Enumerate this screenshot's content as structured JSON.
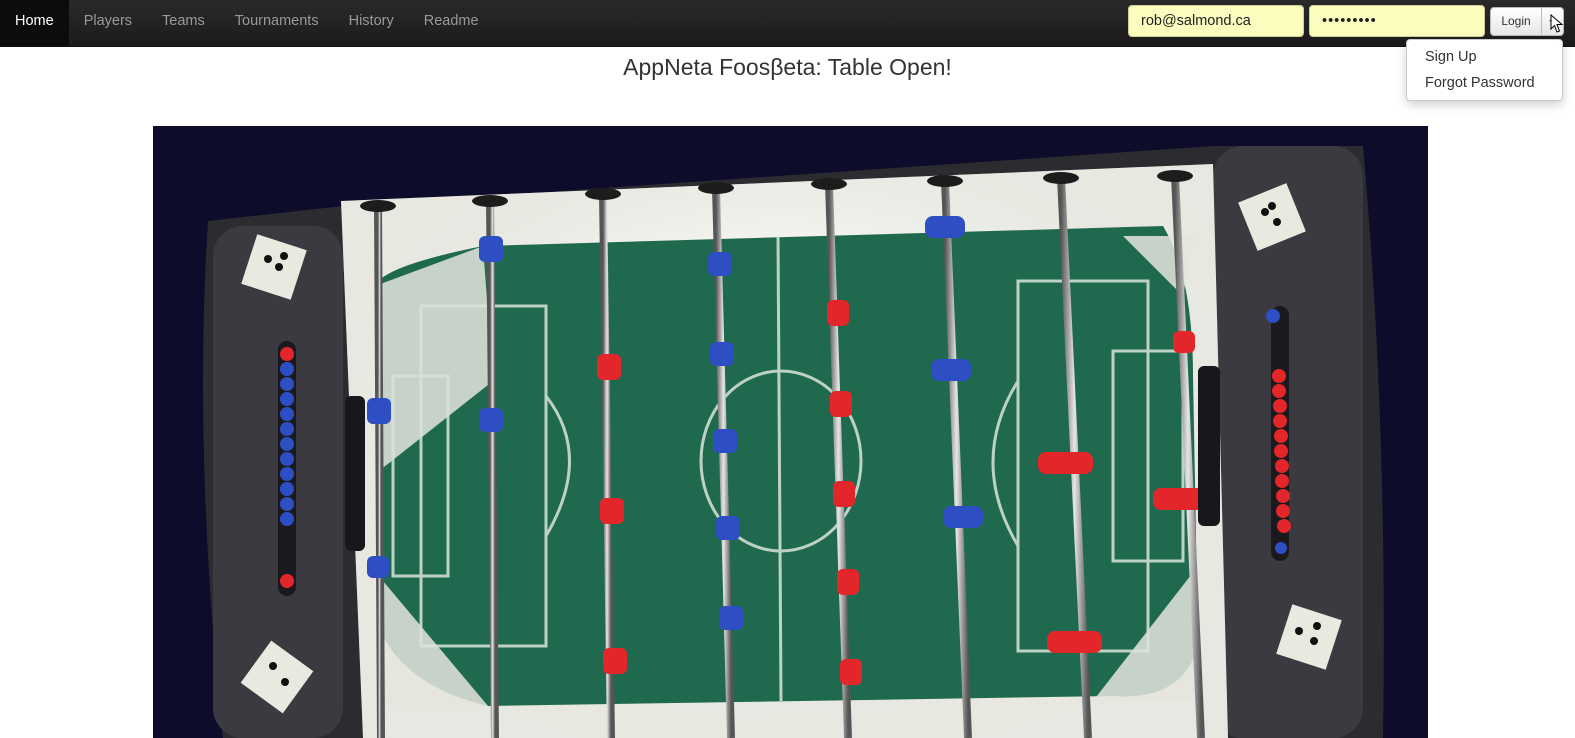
{
  "nav": {
    "items": [
      {
        "label": "Home",
        "active": true
      },
      {
        "label": "Players",
        "active": false
      },
      {
        "label": "Teams",
        "active": false
      },
      {
        "label": "Tournaments",
        "active": false
      },
      {
        "label": "History",
        "active": false
      },
      {
        "label": "Readme",
        "active": false
      }
    ]
  },
  "login": {
    "email_value": "rob@salmond.ca",
    "password_value": "•••••••••",
    "login_label": "Login"
  },
  "dropdown": {
    "items": [
      "Sign Up",
      "Forgot Password"
    ]
  },
  "page": {
    "title": "AppNeta Foosβeta: Table Open!"
  },
  "camera": {
    "scene": "foosball-table-overhead",
    "team_colors": {
      "blue": "#2e4fc4",
      "red": "#e3262a"
    },
    "field_color": "#1f6a4e"
  }
}
